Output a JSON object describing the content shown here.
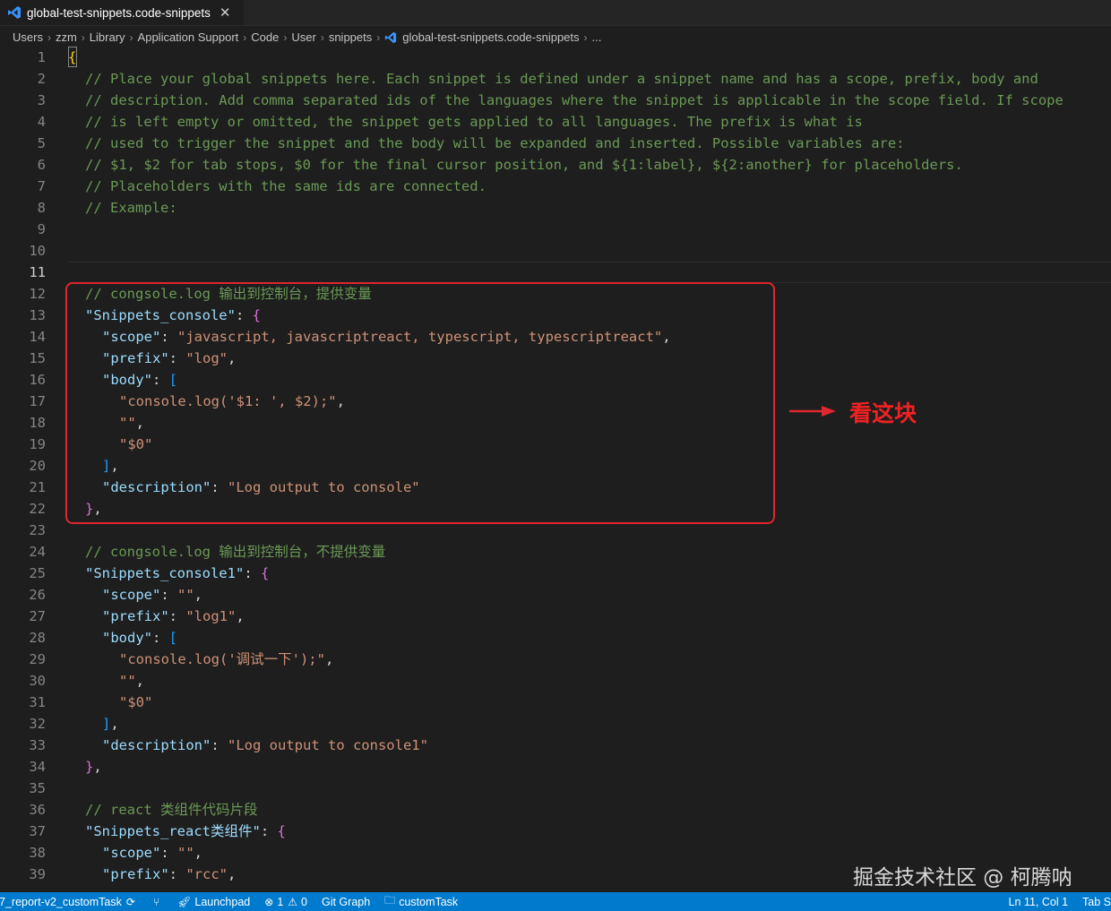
{
  "tab": {
    "title": "global-test-snippets.code-snippets",
    "icon": "vscode-icon"
  },
  "breadcrumb": [
    "Users",
    "zzm",
    "Library",
    "Application Support",
    "Code",
    "User",
    "snippets",
    "global-test-snippets.code-snippets",
    "..."
  ],
  "editor": {
    "active_line": 11,
    "lines": [
      [
        [
          "br1",
          "{"
        ]
      ],
      [
        [
          "cm",
          "\t// Place your global snippets here. Each snippet is defined under a snippet name and has a scope, prefix, body and"
        ]
      ],
      [
        [
          "cm",
          "\t// description. Add comma separated ids of the languages where the snippet is applicable in the scope field. If scope"
        ]
      ],
      [
        [
          "cm",
          "\t// is left empty or omitted, the snippet gets applied to all languages. The prefix is what is"
        ]
      ],
      [
        [
          "cm",
          "\t// used to trigger the snippet and the body will be expanded and inserted. Possible variables are:"
        ]
      ],
      [
        [
          "cm",
          "\t// $1, $2 for tab stops, $0 for the final cursor position, and ${1:label}, ${2:another} for placeholders."
        ]
      ],
      [
        [
          "cm",
          "\t// Placeholders with the same ids are connected."
        ]
      ],
      [
        [
          "cm",
          "\t// Example:"
        ]
      ],
      [],
      [],
      [],
      [
        [
          "cm",
          "\t// congsole.log 输出到控制台，提供变量"
        ]
      ],
      [
        [
          "ky",
          "\t\"Snippets_console\""
        ],
        [
          "pu",
          ": "
        ],
        [
          "br2",
          "{"
        ]
      ],
      [
        [
          "ky",
          "\t\t\"scope\""
        ],
        [
          "pu",
          ": "
        ],
        [
          "st",
          "\"javascript, javascriptreact, typescript, typescriptreact\""
        ],
        [
          "pu",
          ","
        ]
      ],
      [
        [
          "ky",
          "\t\t\"prefix\""
        ],
        [
          "pu",
          ": "
        ],
        [
          "st",
          "\"log\""
        ],
        [
          "pu",
          ","
        ]
      ],
      [
        [
          "ky",
          "\t\t\"body\""
        ],
        [
          "pu",
          ": "
        ],
        [
          "br3",
          "["
        ]
      ],
      [
        [
          "st",
          "\t\t\t\"console.log('$1: ', $2);\""
        ],
        [
          "pu",
          ","
        ]
      ],
      [
        [
          "st",
          "\t\t\t\"\""
        ],
        [
          "pu",
          ","
        ]
      ],
      [
        [
          "st",
          "\t\t\t\"$0\""
        ]
      ],
      [
        [
          "br3",
          "\t\t]"
        ],
        [
          "pu",
          ","
        ]
      ],
      [
        [
          "ky",
          "\t\t\"description\""
        ],
        [
          "pu",
          ": "
        ],
        [
          "st",
          "\"Log output to console\""
        ]
      ],
      [
        [
          "br2",
          "\t}"
        ],
        [
          "pu",
          ","
        ]
      ],
      [],
      [
        [
          "cm",
          "\t// congsole.log 输出到控制台，不提供变量"
        ]
      ],
      [
        [
          "ky",
          "\t\"Snippets_console1\""
        ],
        [
          "pu",
          ": "
        ],
        [
          "br2",
          "{"
        ]
      ],
      [
        [
          "ky",
          "\t\t\"scope\""
        ],
        [
          "pu",
          ": "
        ],
        [
          "st",
          "\"\""
        ],
        [
          "pu",
          ","
        ]
      ],
      [
        [
          "ky",
          "\t\t\"prefix\""
        ],
        [
          "pu",
          ": "
        ],
        [
          "st",
          "\"log1\""
        ],
        [
          "pu",
          ","
        ]
      ],
      [
        [
          "ky",
          "\t\t\"body\""
        ],
        [
          "pu",
          ": "
        ],
        [
          "br3",
          "["
        ]
      ],
      [
        [
          "st",
          "\t\t\t\"console.log('调试一下');\""
        ],
        [
          "pu",
          ","
        ]
      ],
      [
        [
          "st",
          "\t\t\t\"\""
        ],
        [
          "pu",
          ","
        ]
      ],
      [
        [
          "st",
          "\t\t\t\"$0\""
        ]
      ],
      [
        [
          "br3",
          "\t\t]"
        ],
        [
          "pu",
          ","
        ]
      ],
      [
        [
          "ky",
          "\t\t\"description\""
        ],
        [
          "pu",
          ": "
        ],
        [
          "st",
          "\"Log output to console1\""
        ]
      ],
      [
        [
          "br2",
          "\t}"
        ],
        [
          "pu",
          ","
        ]
      ],
      [],
      [
        [
          "cm",
          "\t// react 类组件代码片段"
        ]
      ],
      [
        [
          "ky",
          "\t\"Snippets_react类组件\""
        ],
        [
          "pu",
          ": "
        ],
        [
          "br2",
          "{"
        ]
      ],
      [
        [
          "ky",
          "\t\t\"scope\""
        ],
        [
          "pu",
          ": "
        ],
        [
          "st",
          "\"\""
        ],
        [
          "pu",
          ","
        ]
      ],
      [
        [
          "ky",
          "\t\t\"prefix\""
        ],
        [
          "pu",
          ": "
        ],
        [
          "st",
          "\"rcc\""
        ],
        [
          "pu",
          ","
        ]
      ]
    ]
  },
  "annotation": {
    "text": "看这块",
    "color": "#e0262f"
  },
  "watermark": "掘金技术社区 @ 柯腾呐",
  "statusbar": {
    "branch": "7_report-v2_customTask",
    "launchpad": "Launchpad",
    "errors": "1",
    "warnings": "0",
    "git_graph": "Git Graph",
    "task": "customTask",
    "cursor": "Ln 11, Col 1",
    "indent": "Tab S",
    "color": "#007acc"
  }
}
